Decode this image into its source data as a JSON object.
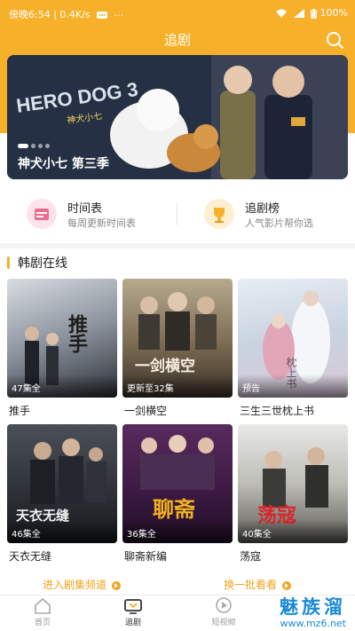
{
  "status_bar": {
    "time": "傍晚6:54",
    "network_speed": "0.4K/s",
    "battery": "100%"
  },
  "header": {
    "title": "追剧"
  },
  "banner": {
    "caption": "神犬小七 第三季",
    "logo_text": "HERO DOG 3",
    "logo_sub": "神犬小七",
    "dot_count": 4,
    "active_dot": 0
  },
  "shortcuts": [
    {
      "title": "时间表",
      "subtitle": "每周更新时间表",
      "icon": "calendar-icon",
      "color": "#f06a8f"
    },
    {
      "title": "追剧榜",
      "subtitle": "人气影片帮你选",
      "icon": "trophy-icon",
      "color": "#f7b02a"
    }
  ],
  "section": {
    "title": "韩剧在线"
  },
  "dramas": [
    {
      "name": "推手",
      "badge": "47集全",
      "poster_text": "推手"
    },
    {
      "name": "一剑横空",
      "badge": "更新至32集",
      "poster_text": "一剑横空"
    },
    {
      "name": "三生三世枕上书",
      "badge": "预告",
      "poster_text": "枕上书"
    },
    {
      "name": "天衣无缝",
      "badge": "46集全",
      "poster_text": "天衣无缝"
    },
    {
      "name": "聊斋新编",
      "badge": "36集全",
      "poster_text": "聊斋"
    },
    {
      "name": "荡寇",
      "badge": "40集全",
      "poster_text": "荡寇"
    }
  ],
  "links": {
    "enter_channel": "进入剧集频道",
    "refresh_batch": "换一批看看"
  },
  "bottom_nav": [
    {
      "label": "首页",
      "icon": "home-icon",
      "active": false
    },
    {
      "label": "追剧",
      "icon": "tv-icon",
      "active": true
    },
    {
      "label": "短视频",
      "icon": "play-icon",
      "active": false
    }
  ],
  "watermark": {
    "brand": "魅族溜",
    "url": "www.mz6.net"
  },
  "colors": {
    "accent": "#f7b02a",
    "link": "#f0a41f",
    "watermark": "#1a8ad6"
  }
}
